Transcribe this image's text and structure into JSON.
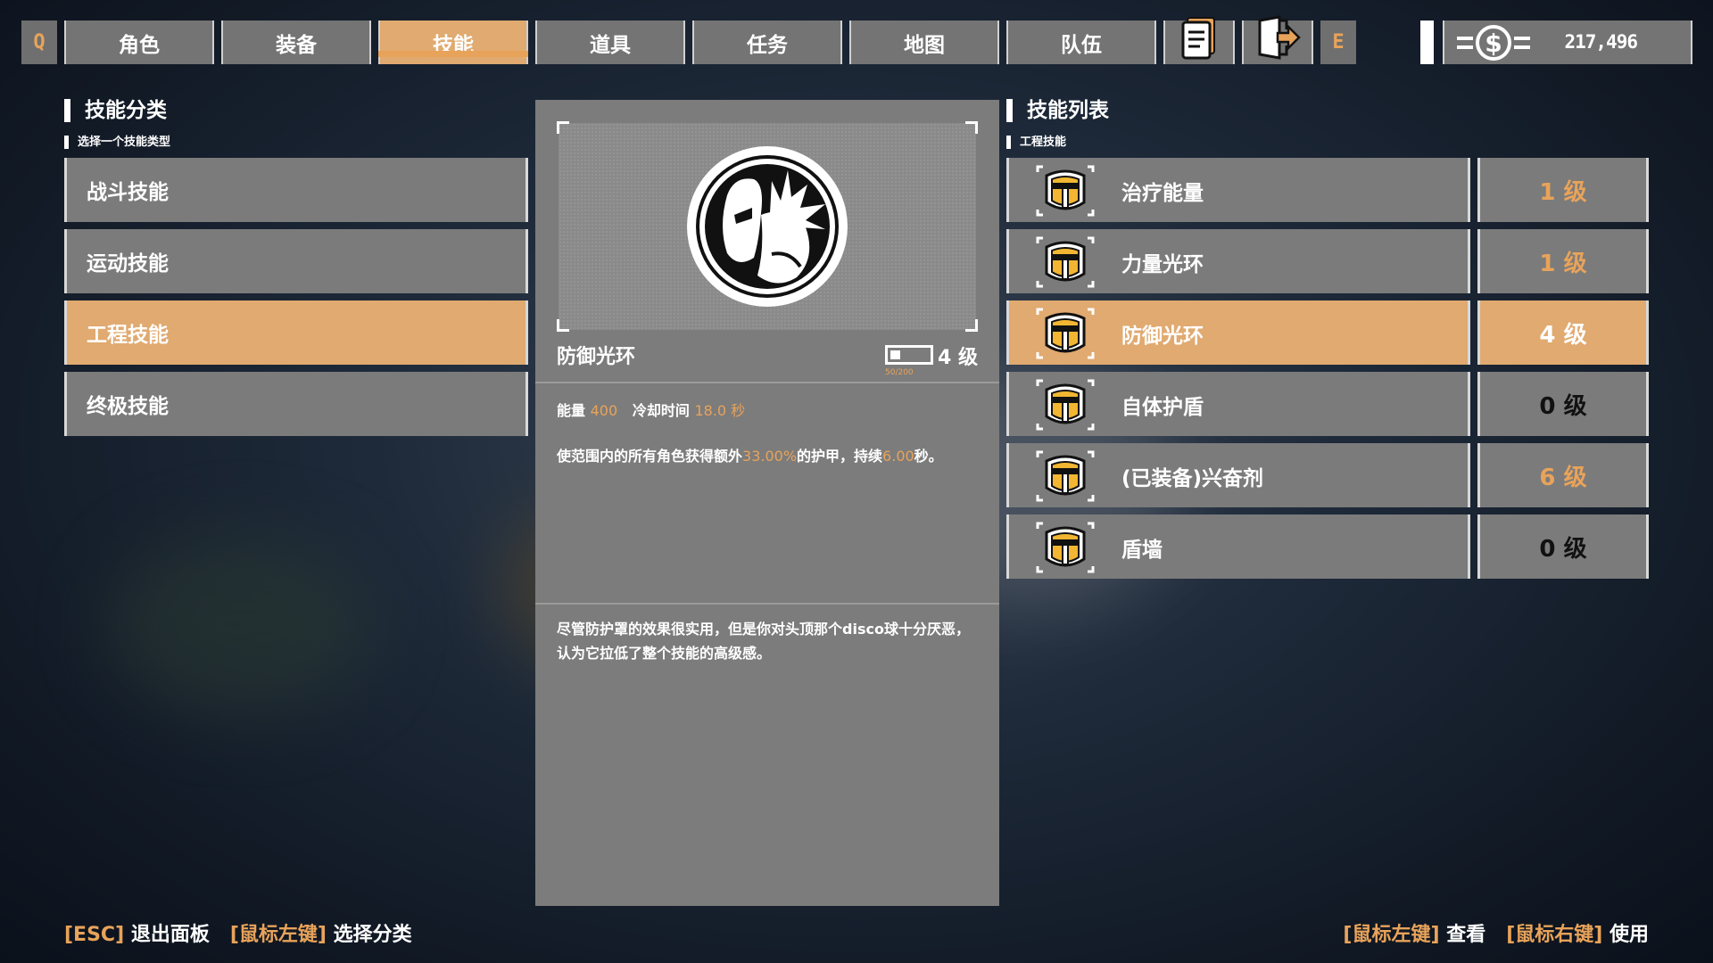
{
  "topbar": {
    "left_key": "Q",
    "right_key": "E",
    "tabs": [
      "角色",
      "装备",
      "技能",
      "道具",
      "任务",
      "地图",
      "队伍"
    ],
    "active_tab": "技能",
    "money": "217,496"
  },
  "categories": {
    "title": "技能分类",
    "subtitle": "选择一个技能类型",
    "items": [
      "战斗技能",
      "运动技能",
      "工程技能",
      "终极技能"
    ],
    "active": "工程技能"
  },
  "detail": {
    "name": "防御光环",
    "level_text": "4 级",
    "xp_text": "50/200",
    "xp_fraction": 0.25,
    "energy_label": "能量",
    "energy_value": "400",
    "cooldown_label": "冷却时间",
    "cooldown_value": "18.0 秒",
    "desc_1": "使范围内的所有角色获得额外",
    "desc_pct": "33.00%",
    "desc_2": "的护甲，持续",
    "desc_time": "6.00",
    "desc_3": "秒。",
    "flavor": "尽管防护罩的效果很实用，但是你对头顶那个disco球十分厌恶，认为它拉低了整个技能的高级感。"
  },
  "skills": {
    "title": "技能列表",
    "subtitle": "工程技能",
    "items": [
      {
        "name": "治疗能量",
        "level": "1 级",
        "level_color": "orange"
      },
      {
        "name": "力量光环",
        "level": "1 级",
        "level_color": "orange"
      },
      {
        "name": "防御光环",
        "level": "4 级",
        "level_color": "white"
      },
      {
        "name": "自体护盾",
        "level": "0 级",
        "level_color": "black"
      },
      {
        "name": "(已装备)兴奋剂",
        "level": "6 级",
        "level_color": "orange"
      },
      {
        "name": "盾墙",
        "level": "0 级",
        "level_color": "black"
      }
    ],
    "active_index": 2
  },
  "hints": {
    "left": [
      {
        "key": "[ESC]",
        "text": "退出面板"
      },
      {
        "key": "[鼠标左键]",
        "text": "选择分类"
      }
    ],
    "right": [
      {
        "key": "[鼠标左键]",
        "text": "查看"
      },
      {
        "key": "[鼠标右键]",
        "text": "使用"
      }
    ]
  },
  "colors": {
    "accent": "#e0aa70",
    "accent_text": "#e8a35a",
    "panel": "#7b7b7b"
  }
}
